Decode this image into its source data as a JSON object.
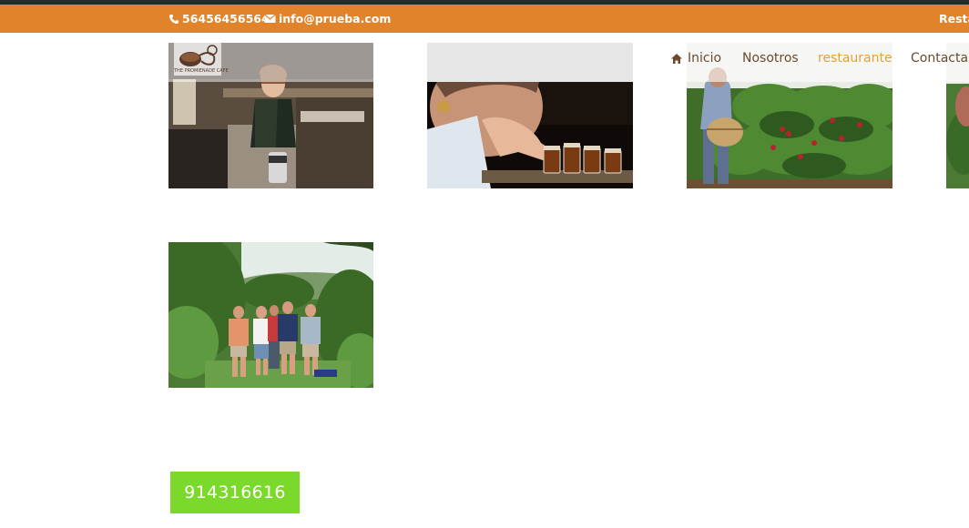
{
  "topbar": {
    "phone": "56456456564",
    "email": "info@prueba.com",
    "right_link": "Resta"
  },
  "logo": {
    "text": "THE PROMIENADE CAFE"
  },
  "nav": {
    "home": "Inicio",
    "about": "Nosotros",
    "restaurant": "restaurante",
    "contact": "Contactar"
  },
  "gallery": [
    {
      "name": "barista-photo"
    },
    {
      "name": "coffee-tasting-photo"
    },
    {
      "name": "coffee-picker-photo"
    },
    {
      "name": "partial-photo"
    },
    {
      "name": "group-plantation-photo"
    }
  ],
  "cta": {
    "label": "914316616"
  },
  "colors": {
    "topbar_bg": "#e0832a",
    "nav_text": "#6b4a2e",
    "nav_active": "#e8a033",
    "cta_bg": "#7bd92b"
  }
}
